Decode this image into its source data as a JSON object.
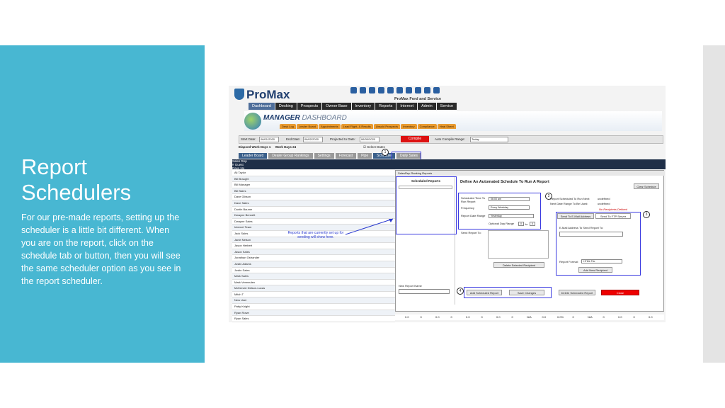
{
  "slide": {
    "title_line1": "Report",
    "title_line2": "Schedulers",
    "body": "For our pre-made reports, setting up the scheduler is a little bit different. When you are on the report, click on the schedule tab or button, then you will see the same scheduler option as you see in the report scheduler."
  },
  "app": {
    "logo": "ProMax",
    "dealer": "ProMax Ford and Service",
    "nav": [
      "Dashboard",
      "Desking",
      "Prospects",
      "Owner Base",
      "Inventory",
      "Reports",
      "Internet",
      "Admin",
      "Service"
    ],
    "banner_main": "MANAGER",
    "banner_sub": "DASHBOARD",
    "subtabs": [
      "Desk Log",
      "Leader Board",
      "Appointments",
      "Lead Flight, & Results",
      "Unsold Prospects",
      "Inventory",
      "Compliance",
      "Heat Sheet"
    ],
    "filters": {
      "start_label": "Start Date:",
      "start": "06/01/2020",
      "end_label": "End Date:",
      "end": "06/02/2020",
      "proj_label": "Projected to Date:",
      "proj": "06/30/2020",
      "compile": "Compile",
      "auto_label": "Auto Compile Range:",
      "auto": "Today",
      "select_dates": "Select Dates"
    },
    "elapsed": "Elapsed Work Days 1",
    "workdays": "Work Days 24",
    "tabs": [
      "Leader Board",
      "Dealer Group Rankings",
      "Settings",
      "Forecast",
      "Pipe",
      "Schedule",
      "Daily Sales"
    ],
    "header": [
      "Sales Rep",
      "# Guest",
      "Days No Sale",
      "# New Units",
      "# New Gross",
      "New Avg",
      "# Used Units",
      "# Used Gross",
      "Used Avg",
      "Total Sold",
      "Closing Ratio",
      "Total Gross",
      "Total Avg Gross",
      "Total Reserve",
      "# Svc Contracts",
      "Gross Svc Contract",
      "# GAP Contracts"
    ],
    "reps": [
      "Ali Taylor",
      "Bill Braught",
      "Bill Manager",
      "Bill Sales",
      "Dave Gibson",
      "Dave Sales",
      "Dustin Baume",
      "Dwayne Bennett",
      "Dwayne Sales",
      "Internet Team",
      "Jack Sales",
      "Janie Nelson",
      "Jason Herbert",
      "Jason Sales",
      "Jonathan Ostrander",
      "Justin Adams",
      "Justin Sales",
      "Mark Sales",
      "Mark Vermeulen",
      "McKenzie Nelson-Lucas",
      "Mitch T",
      "New User",
      "Patty Knight",
      "Ryan Rowe",
      "Ryan Sales"
    ],
    "dialog": {
      "caption": "SalesRep Ranking Reports",
      "title": "Define An Automated Schedule To Run A Report",
      "clear": "Clear Schedule",
      "scheduled_reports": "Scheduled Reports",
      "sched_time_label": "Scheduled Time To Run Report",
      "sched_time": "06:00 am",
      "frequency_label": "Frequency",
      "frequency": "Every Weekday",
      "date_range_label": "Report Date Range",
      "date_range": "Yesterday",
      "optional_label": "Optional Day Range",
      "opt_from": "0",
      "opt_to": "0",
      "to": "to",
      "send_to_label": "Send Report To:",
      "delete_recipient": "Delete Selected Recipient",
      "next_run_label": "Report Scheduled To Run Next:",
      "next_run": "undefined",
      "next_range_label": "Next Date Range To Be Used:",
      "next_range": "undefined",
      "no_recip": "No Recipients Defined",
      "email_tab": "Send To E-Mail Address",
      "ftp_tab": "Send To FTP Server",
      "email_label": "E-Mail Address To Send Report To:",
      "format_label": "Report Format:",
      "format": "HTML File",
      "add_recipient": "Add New Recipient",
      "new_report_name": "New Report Name",
      "add_report": "Add Scheduled Report",
      "save": "Save Changes",
      "delete_report": "Delete Scheduled Report",
      "close": "Close"
    },
    "callout": "Reports that are currently set up for sending will show here.",
    "markers": [
      "1",
      "2",
      "3",
      "4"
    ],
    "totals": [
      "0.0",
      "0",
      "0.0",
      "0",
      "0.0",
      "0",
      "0.0",
      "0",
      "N/A",
      "0.0",
      "0.0%",
      "0",
      "N/A",
      "0",
      "0.0",
      "0",
      "0.0"
    ]
  }
}
